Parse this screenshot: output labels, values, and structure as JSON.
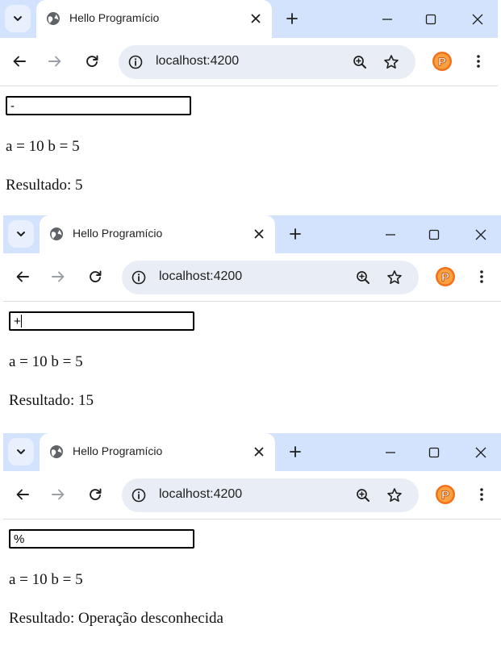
{
  "windows": [
    {
      "tab_title": "Hello Programício",
      "url": "localhost:4200",
      "operator_value": "-",
      "vars_text": "a = 10 b = 5",
      "result_label": "Resultado:",
      "result_value": "5",
      "focused": false
    },
    {
      "tab_title": "Hello Programício",
      "url": "localhost:4200",
      "operator_value": "+",
      "vars_text": "a = 10 b = 5",
      "result_label": "Resultado:",
      "result_value": "15",
      "focused": true
    },
    {
      "tab_title": "Hello Programício",
      "url": "localhost:4200",
      "operator_value": "%",
      "vars_text": "a = 10 b = 5",
      "result_label": "Resultado:",
      "result_value": "Operação desconhecida",
      "focused": false
    }
  ],
  "icons": {
    "tab_list": "chevron-down-icon",
    "favicon": "globe-icon",
    "tab_close": "close-icon",
    "new_tab": "plus-icon",
    "minimize": "minimize-icon",
    "maximize": "maximize-icon",
    "window_close": "close-icon",
    "back": "arrow-left-icon",
    "forward": "arrow-right-icon",
    "reload": "reload-icon",
    "site_info": "info-icon",
    "zoom": "zoom-in-icon",
    "bookmark": "star-icon",
    "extension": "extension-p-icon",
    "menu": "kebab-menu-icon"
  },
  "colors": {
    "tabstrip_bg": "#d3e3fd",
    "omnibox_bg": "#e9eef6",
    "extension_orange": "#f2711c"
  }
}
